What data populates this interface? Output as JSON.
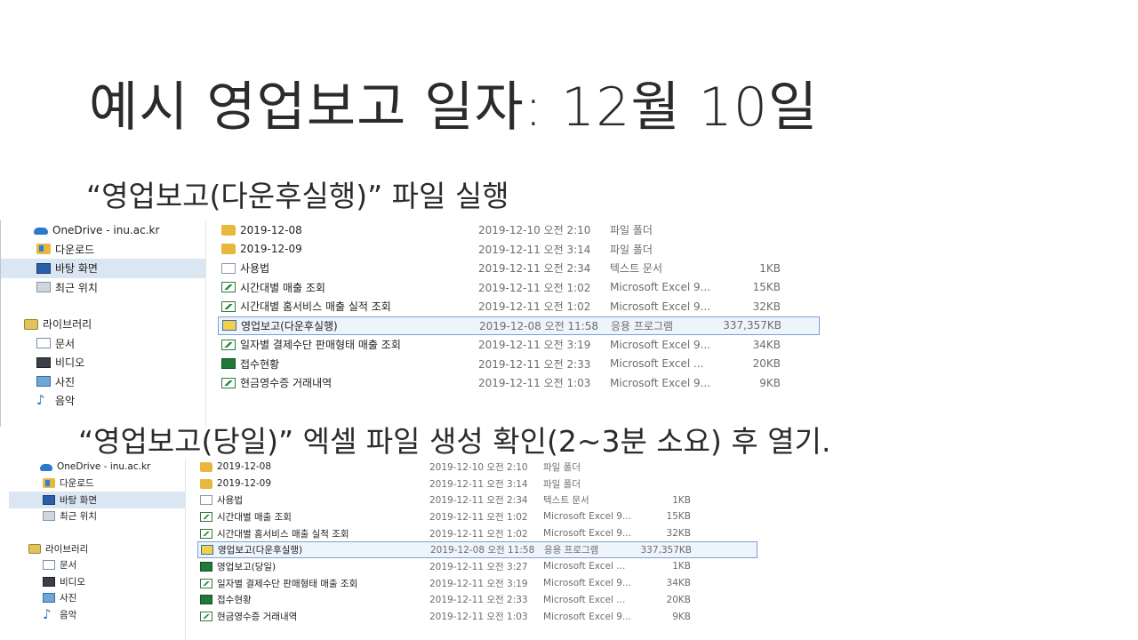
{
  "slide": {
    "title": "예시 영업보고 일자: 12월 10일",
    "caption1": "“영업보고(다운후실행)” 파일 실행",
    "caption2": "“영업보고(당일)” 엑셀 파일 생성 확인(2~3분 소요) 후 열기."
  },
  "nav": {
    "onedrive": "OneDrive - inu.ac.kr",
    "downloads": "다운로드",
    "desktop": "바탕 화면",
    "recent": "최근 위치",
    "libraries": "라이브러리",
    "documents": "문서",
    "videos": "비디오",
    "pictures": "사진",
    "music": "음악"
  },
  "explorer1": {
    "files": [
      {
        "name": "2019-12-08",
        "date": "2019-12-10 오전 2:10",
        "type": "파일 폴더",
        "size": "",
        "icon": "folder-icon"
      },
      {
        "name": "2019-12-09",
        "date": "2019-12-11 오전 3:14",
        "type": "파일 폴더",
        "size": "",
        "icon": "folder-icon"
      },
      {
        "name": "사용법",
        "date": "2019-12-11 오전 2:34",
        "type": "텍스트 문서",
        "size": "1KB",
        "icon": "text-file-icon"
      },
      {
        "name": "시간대별 매출 조회",
        "date": "2019-12-11 오전 1:02",
        "type": "Microsoft Excel 9...",
        "size": "15KB",
        "icon": "excel-file-icon"
      },
      {
        "name": "시간대별 홈서비스 매출 실적 조회",
        "date": "2019-12-11 오전 1:02",
        "type": "Microsoft Excel 9...",
        "size": "32KB",
        "icon": "excel-file-icon"
      },
      {
        "name": "영업보고(다운후실행)",
        "date": "2019-12-08 오전 11:58",
        "type": "응용 프로그램",
        "size": "337,357KB",
        "icon": "application-icon",
        "selected": true
      },
      {
        "name": "일자별 결제수단 판매형태 매출 조회",
        "date": "2019-12-11 오전 3:19",
        "type": "Microsoft Excel 9...",
        "size": "34KB",
        "icon": "excel-file-icon"
      },
      {
        "name": "접수현황",
        "date": "2019-12-11 오전 2:33",
        "type": "Microsoft Excel ...",
        "size": "20KB",
        "icon": "excel-workbook-icon"
      },
      {
        "name": "현금영수증 거래내역",
        "date": "2019-12-11 오전 1:03",
        "type": "Microsoft Excel 9...",
        "size": "9KB",
        "icon": "excel-file-icon"
      }
    ]
  },
  "explorer2": {
    "files": [
      {
        "name": "2019-12-08",
        "date": "2019-12-10 오전 2:10",
        "type": "파일 폴더",
        "size": "",
        "icon": "folder-icon"
      },
      {
        "name": "2019-12-09",
        "date": "2019-12-11 오전 3:14",
        "type": "파일 폴더",
        "size": "",
        "icon": "folder-icon"
      },
      {
        "name": "사용법",
        "date": "2019-12-11 오전 2:34",
        "type": "텍스트 문서",
        "size": "1KB",
        "icon": "text-file-icon"
      },
      {
        "name": "시간대별 매출 조회",
        "date": "2019-12-11 오전 1:02",
        "type": "Microsoft Excel 9...",
        "size": "15KB",
        "icon": "excel-file-icon"
      },
      {
        "name": "시간대별 홈서비스 매출 실적 조회",
        "date": "2019-12-11 오전 1:02",
        "type": "Microsoft Excel 9...",
        "size": "32KB",
        "icon": "excel-file-icon"
      },
      {
        "name": "영업보고(다운후실행)",
        "date": "2019-12-08 오전 11:58",
        "type": "응용 프로그램",
        "size": "337,357KB",
        "icon": "application-icon",
        "selected": true
      },
      {
        "name": "영업보고(당일)",
        "date": "2019-12-11 오전 3:27",
        "type": "Microsoft Excel ...",
        "size": "1KB",
        "icon": "excel-workbook-icon"
      },
      {
        "name": "일자별 결제수단 판매형태 매출 조회",
        "date": "2019-12-11 오전 3:19",
        "type": "Microsoft Excel 9...",
        "size": "34KB",
        "icon": "excel-file-icon"
      },
      {
        "name": "접수현황",
        "date": "2019-12-11 오전 2:33",
        "type": "Microsoft Excel ...",
        "size": "20KB",
        "icon": "excel-workbook-icon"
      },
      {
        "name": "현금영수증 거래내역",
        "date": "2019-12-11 오전 1:03",
        "type": "Microsoft Excel 9...",
        "size": "9KB",
        "icon": "excel-file-icon"
      }
    ]
  }
}
